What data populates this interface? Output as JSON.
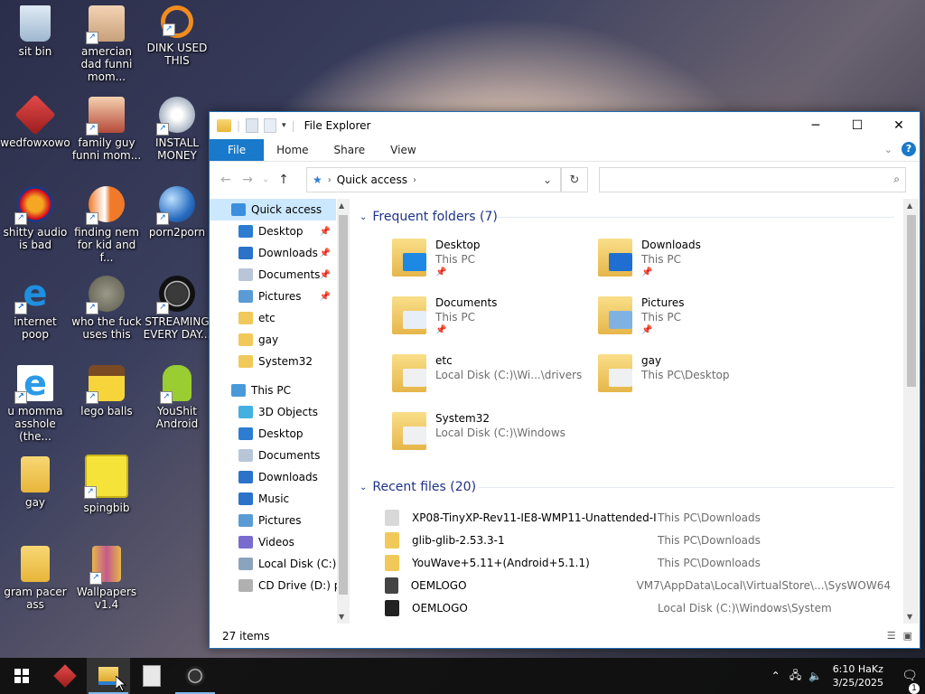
{
  "desktop": {
    "icons": [
      {
        "label": "sit bin",
        "shortcut": false
      },
      {
        "label": "amercian dad funni mom...",
        "shortcut": true
      },
      {
        "label": "DINK USED THIS",
        "shortcut": true
      },
      {
        "label": "wedfowxowo",
        "shortcut": true
      },
      {
        "label": "family guy funni mom...",
        "shortcut": true
      },
      {
        "label": "INSTALL MONEY",
        "shortcut": true
      },
      {
        "label": "shitty audio is bad",
        "shortcut": true
      },
      {
        "label": "finding nem for kid and f...",
        "shortcut": true
      },
      {
        "label": "porn2porn",
        "shortcut": true
      },
      {
        "label": "internet poop",
        "shortcut": true
      },
      {
        "label": "who the fuck uses this",
        "shortcut": true
      },
      {
        "label": "STREAMING EVERY DAY...",
        "shortcut": true
      },
      {
        "label": "u momma asshole (the...",
        "shortcut": true
      },
      {
        "label": "lego balls",
        "shortcut": true
      },
      {
        "label": "YouShit Android",
        "shortcut": true
      },
      {
        "label": "gay",
        "shortcut": false
      },
      {
        "label": "spingbib",
        "shortcut": true
      },
      {
        "label": "gram pacer ass",
        "shortcut": false
      },
      {
        "label": "Wallpapers v1.4",
        "shortcut": true
      }
    ]
  },
  "window": {
    "title": "File Explorer",
    "ribbon_tabs": [
      "File",
      "Home",
      "Share",
      "View"
    ],
    "controls": {
      "minimize": "─",
      "maximize": "☐",
      "close": "✕"
    },
    "address": {
      "location": "Quick access",
      "search_placeholder": ""
    },
    "nav": [
      {
        "label": "Quick access",
        "pinned": false,
        "color": "#3c8fde",
        "selected": true,
        "indent": 1
      },
      {
        "label": "Desktop",
        "pinned": true,
        "color": "#2c7cd1",
        "indent": 2
      },
      {
        "label": "Downloads",
        "pinned": true,
        "color": "#2a73c9",
        "indent": 2
      },
      {
        "label": "Documents",
        "pinned": true,
        "color": "#b8c6d8",
        "indent": 2
      },
      {
        "label": "Pictures",
        "pinned": true,
        "color": "#5b9bd5",
        "indent": 2
      },
      {
        "label": "etc",
        "pinned": false,
        "color": "#f1c95a",
        "indent": 2
      },
      {
        "label": "gay",
        "pinned": false,
        "color": "#f1c95a",
        "indent": 2
      },
      {
        "label": "System32",
        "pinned": false,
        "color": "#f1c95a",
        "indent": 2
      },
      {
        "label": "This PC",
        "pinned": false,
        "color": "#4a9ad9",
        "indent": 1
      },
      {
        "label": "3D Objects",
        "pinned": false,
        "color": "#43b0e0",
        "indent": 2
      },
      {
        "label": "Desktop",
        "pinned": false,
        "color": "#2c7cd1",
        "indent": 2
      },
      {
        "label": "Documents",
        "pinned": false,
        "color": "#b8c6d8",
        "indent": 2
      },
      {
        "label": "Downloads",
        "pinned": false,
        "color": "#2a73c9",
        "indent": 2
      },
      {
        "label": "Music",
        "pinned": false,
        "color": "#2a73c9",
        "indent": 2
      },
      {
        "label": "Pictures",
        "pinned": false,
        "color": "#5b9bd5",
        "indent": 2
      },
      {
        "label": "Videos",
        "pinned": false,
        "color": "#7a6bd0",
        "indent": 2
      },
      {
        "label": "Local Disk (C:)",
        "pinned": false,
        "color": "#8aa4bd",
        "indent": 2
      },
      {
        "label": "CD Drive (D:) pe",
        "pinned": false,
        "color": "#b0b0b0",
        "indent": 2
      }
    ],
    "frequent": {
      "header": "Frequent folders (7)",
      "items": [
        {
          "name": "Desktop",
          "location": "This PC",
          "pinned": true,
          "accent": "#1e88e5"
        },
        {
          "name": "Downloads",
          "location": "This PC",
          "pinned": true,
          "accent": "#1e6fd1"
        },
        {
          "name": "Documents",
          "location": "This PC",
          "pinned": true,
          "accent": "#e8eef6"
        },
        {
          "name": "Pictures",
          "location": "This PC",
          "pinned": true,
          "accent": "#7fb2e3"
        },
        {
          "name": "etc",
          "location": "Local Disk (C:)\\Wi...\\drivers",
          "pinned": false,
          "accent": "#eef0f2"
        },
        {
          "name": "gay",
          "location": "This PC\\Desktop",
          "pinned": false,
          "accent": "#eef0f2"
        },
        {
          "name": "System32",
          "location": "Local Disk (C:)\\Windows",
          "pinned": false,
          "accent": "#eef0f2"
        }
      ]
    },
    "recent": {
      "header": "Recent files (20)",
      "items": [
        {
          "name": "XP08-TinyXP-Rev11-IE8-WMP11-Unattended-I...",
          "location": "This PC\\Downloads",
          "color": "#d8d8d8"
        },
        {
          "name": "glib-glib-2.53.3-1",
          "location": "This PC\\Downloads",
          "color": "#f1c95a"
        },
        {
          "name": "YouWave+5.11+(Android+5.1.1)",
          "location": "This PC\\Downloads",
          "color": "#f1c95a"
        },
        {
          "name": "OEMLOGO",
          "location": "VM7\\AppData\\Local\\VirtualStore\\...\\SysWOW64",
          "color": "#444444"
        },
        {
          "name": "OEMLOGO",
          "location": "Local Disk (C:)\\Windows\\System",
          "color": "#222222"
        }
      ]
    },
    "status": "27 items"
  },
  "taskbar": {
    "time": "6:10 HaKz",
    "date": "3/25/2025",
    "notifications": "1"
  }
}
